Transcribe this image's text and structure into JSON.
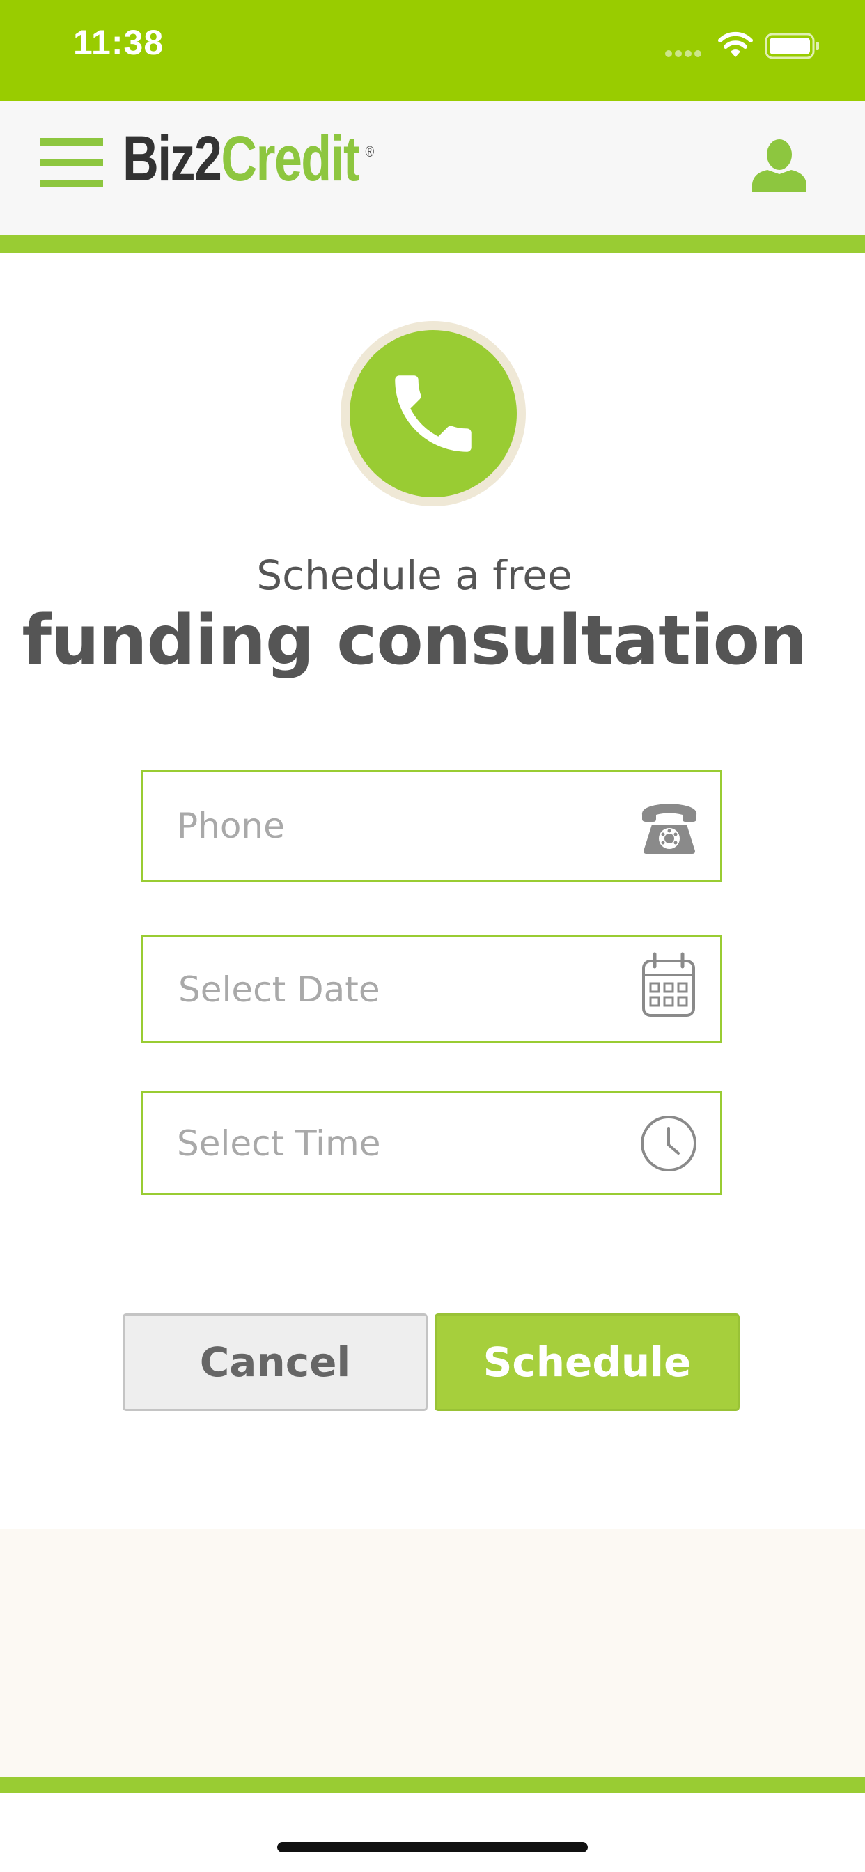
{
  "status_bar": {
    "time": "11:38",
    "background_color": "#99cc00",
    "icons": [
      "signal-dots-icon",
      "wifi-icon",
      "battery-icon"
    ]
  },
  "header": {
    "menu_icon": "hamburger-menu-icon",
    "logo": {
      "part_dark": "Biz2",
      "part_green": "Credit",
      "registered_mark": "®"
    },
    "profile_icon": "user-profile-icon",
    "accent_color": "#99cc33"
  },
  "content": {
    "badge_icon": "phone-handset-icon",
    "subtitle": "Schedule a free",
    "title": "funding consultation"
  },
  "form": {
    "phone": {
      "placeholder": "Phone",
      "icon": "rotary-telephone-icon"
    },
    "date": {
      "placeholder": "Select Date",
      "icon": "calendar-icon"
    },
    "time": {
      "placeholder": "Select Time",
      "icon": "clock-icon"
    }
  },
  "buttons": {
    "cancel_label": "Cancel",
    "schedule_label": "Schedule"
  }
}
